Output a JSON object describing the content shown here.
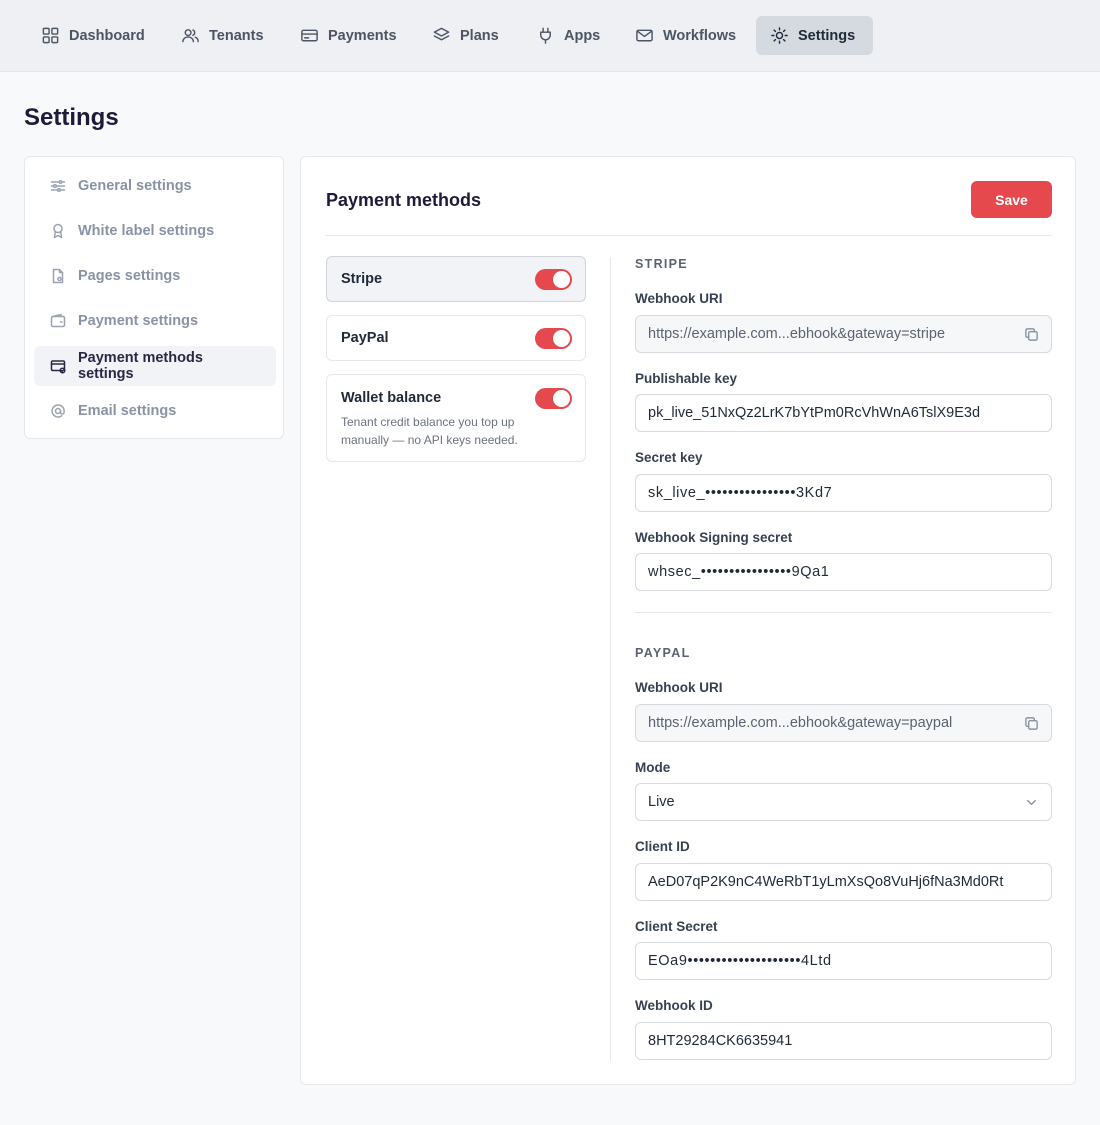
{
  "nav": {
    "items": [
      {
        "label": "Dashboard",
        "icon": "grid-icon"
      },
      {
        "label": "Tenants",
        "icon": "users-icon"
      },
      {
        "label": "Payments",
        "icon": "credit-card-icon"
      },
      {
        "label": "Plans",
        "icon": "layers-icon"
      },
      {
        "label": "Apps",
        "icon": "plug-icon"
      },
      {
        "label": "Workflows",
        "icon": "mail-icon"
      },
      {
        "label": "Settings",
        "icon": "sun-gear-icon",
        "active": true
      }
    ]
  },
  "page": {
    "title": "Settings"
  },
  "sidebar": {
    "items": [
      {
        "label": "General settings",
        "icon": "sliders-icon"
      },
      {
        "label": "White label settings",
        "icon": "badge-icon"
      },
      {
        "label": "Pages settings",
        "icon": "file-icon"
      },
      {
        "label": "Payment settings",
        "icon": "wallet-icon"
      },
      {
        "label": "Payment methods settings",
        "icon": "card-check-icon",
        "active": true
      },
      {
        "label": "Email settings",
        "icon": "at-icon"
      }
    ]
  },
  "card": {
    "title": "Payment methods",
    "save_label": "Save"
  },
  "methods": [
    {
      "name": "Stripe",
      "enabled": true,
      "selected": true
    },
    {
      "name": "PayPal",
      "enabled": true
    },
    {
      "name": "Wallet balance",
      "enabled": true,
      "description": "Tenant credit balance you top up manually — no API keys needed."
    }
  ],
  "stripe": {
    "section_label": "STRIPE",
    "webhook_uri_label": "Webhook URI",
    "webhook_uri": "https://example.com...ebhook&gateway=stripe",
    "publishable_key_label": "Publishable key",
    "publishable_key": "pk_live_51NxQz2LrK7bYtPm0RcVhWnA6TslX9E3d",
    "secret_key_label": "Secret key",
    "secret_key": "sk_live_••••••••••••••••3Kd7",
    "signing_secret_label": "Webhook Signing secret",
    "signing_secret": "whsec_••••••••••••••••9Qa1"
  },
  "paypal": {
    "section_label": "PAYPAL",
    "webhook_uri_label": "Webhook URI",
    "webhook_uri": "https://example.com...ebhook&gateway=paypal",
    "mode_label": "Mode",
    "mode": "Live",
    "client_id_label": "Client ID",
    "client_id": "AeD07qP2K9nC4WeRbT1yLmXsQo8VuHj6fNa3Md0Rt",
    "client_secret_label": "Client Secret",
    "client_secret": "EOa9••••••••••••••••••••4Ltd",
    "webhook_id_label": "Webhook ID",
    "webhook_id": "8HT29284CK6635941"
  },
  "colors": {
    "accent": "#e5484d",
    "nav_bg": "#eef0f3",
    "active_nav": "#d5dae1"
  }
}
